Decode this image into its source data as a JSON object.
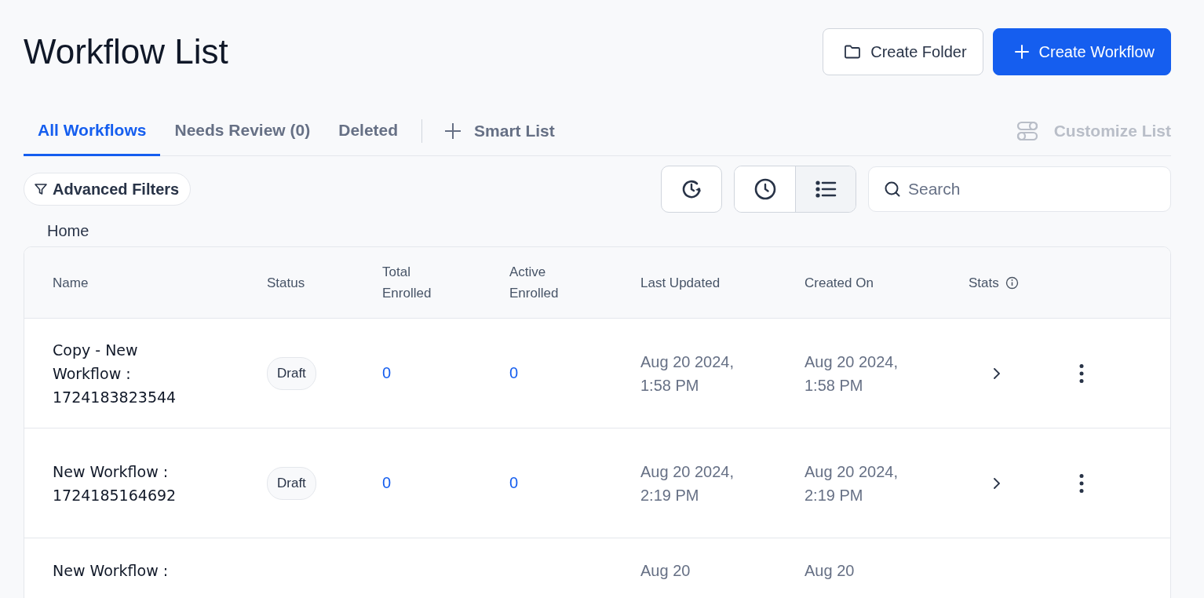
{
  "title": "Workflow List",
  "header_buttons": [
    {
      "label": "Create Folder",
      "kind": "secondary"
    },
    {
      "label": "Create Workflow",
      "kind": "primary"
    }
  ],
  "tabs": [
    {
      "label": "All Workflows",
      "selected": true
    },
    {
      "label": "Needs Review (0)",
      "selected": false
    },
    {
      "label": "Deleted",
      "selected": false
    }
  ],
  "smart_list": {
    "label": "Smart List"
  },
  "customize_list": {
    "label": "Customize List",
    "disabled": true
  },
  "advanced_filters": {
    "label": "Advanced Filters"
  },
  "view_modes": [
    {
      "kind": "clock",
      "selected": false
    },
    {
      "kind": "list",
      "selected": true
    }
  ],
  "search": {
    "placeholder": "Search"
  },
  "breadcrumb": "Home",
  "table": {
    "columns": [
      "Name",
      "Status",
      "Total Enrolled",
      "Active Enrolled",
      "Last Updated",
      "Created On",
      "Stats"
    ],
    "rows": [
      {
        "name": "Copy - New Workflow : 1724183823544",
        "status": "Draft",
        "total_enrolled": "0",
        "active_enrolled": "0",
        "last_updated": "Aug 20 2024, 1:58 PM",
        "created_on": "Aug 20 2024, 1:58 PM"
      },
      {
        "name": "New Workflow : 1724185164692",
        "status": "Draft",
        "total_enrolled": "0",
        "active_enrolled": "0",
        "last_updated": "Aug 20 2024, 2:19 PM",
        "created_on": "Aug 20 2024, 2:19 PM"
      },
      {
        "name": "New Workflow :",
        "last_updated": "Aug 20",
        "created_on": "Aug 20"
      }
    ]
  }
}
